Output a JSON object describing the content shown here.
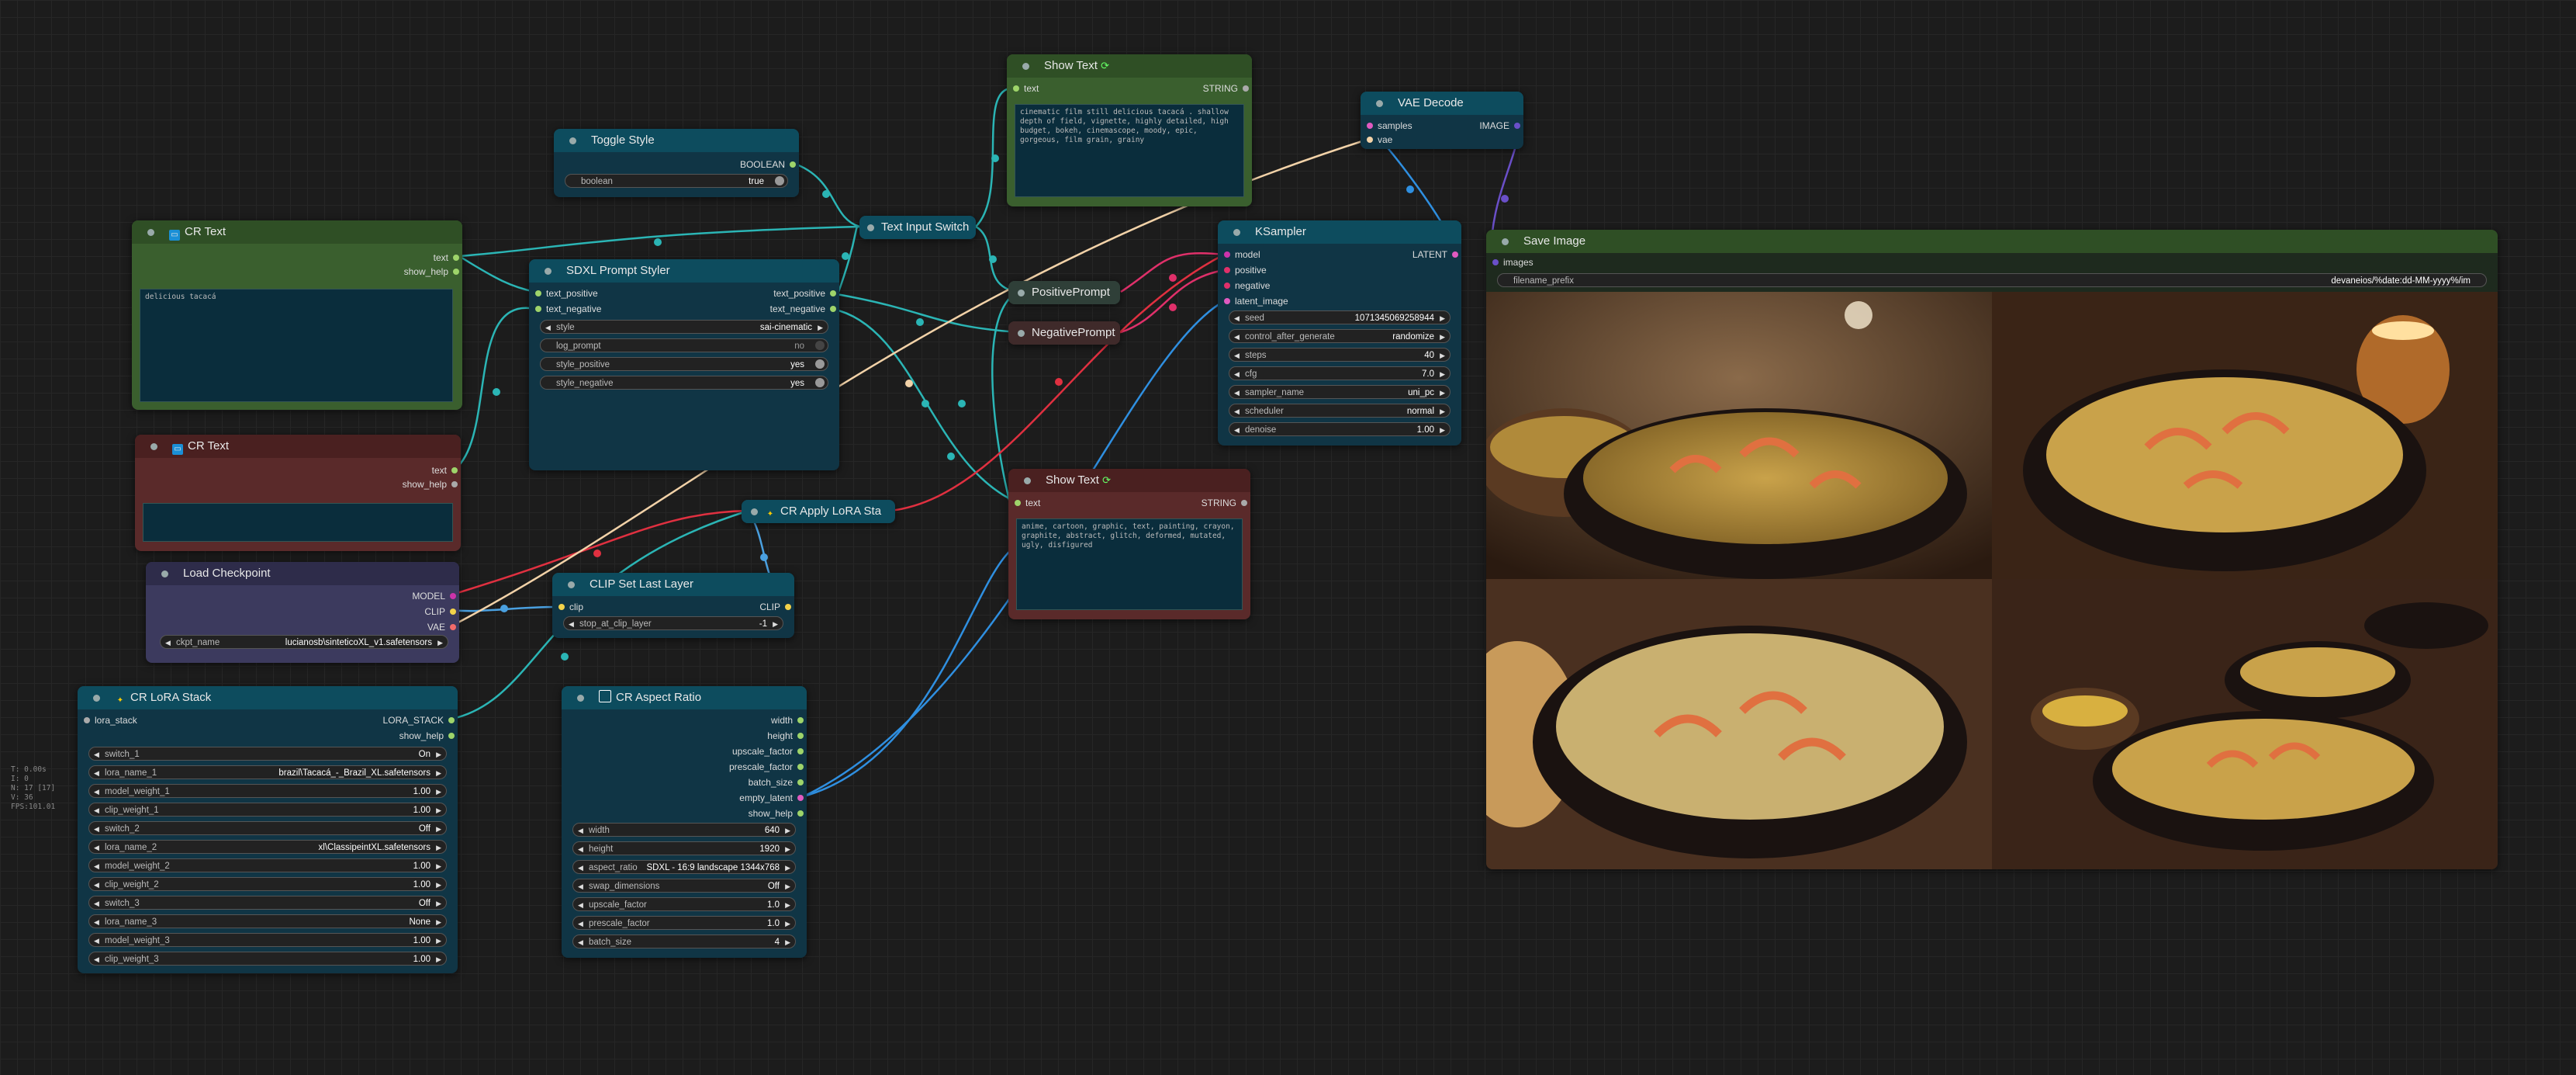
{
  "stats": [
    "T: 0.00s",
    "I: 0",
    "N: 17 [17]",
    "V: 36",
    "FPS:101.01"
  ],
  "cr_text_1": {
    "title": "CR Text",
    "out_text": "text",
    "out_help": "show_help",
    "value": "delicious tacacá"
  },
  "cr_text_2": {
    "title": "CR Text",
    "out_text": "text",
    "out_help": "show_help",
    "value": ""
  },
  "toggle": {
    "title": "Toggle Style",
    "out": "BOOLEAN",
    "w_label": "boolean",
    "w_value": "true"
  },
  "text_switch": {
    "title": "Text Input Switch"
  },
  "sdxl": {
    "title": "SDXL Prompt Styler",
    "in1": "text_positive",
    "in2": "text_negative",
    "out1": "text_positive",
    "out2": "text_negative",
    "widgets": [
      {
        "label": "style",
        "value": "sai-cinematic"
      },
      {
        "label": "log_prompt",
        "value": "no"
      },
      {
        "label": "style_positive",
        "value": "yes"
      },
      {
        "label": "style_negative",
        "value": "yes"
      }
    ]
  },
  "show_text_1": {
    "title": "Show Text",
    "in": "text",
    "out": "STRING",
    "value": "cinematic film still delicious tacacá . shallow depth of field, vignette, highly detailed, high budget, bokeh, cinemascope, moody, epic, gorgeous, film grain, grainy"
  },
  "show_text_2": {
    "title": "Show Text",
    "in": "text",
    "out": "STRING",
    "value": "anime, cartoon, graphic, text, painting, crayon, graphite, abstract, glitch, deformed, mutated, ugly, disfigured"
  },
  "pos_prompt": {
    "title": "PositivePrompt"
  },
  "neg_prompt": {
    "title": "NegativePrompt"
  },
  "vae_decode": {
    "title": "VAE Decode",
    "in1": "samples",
    "in2": "vae",
    "out": "IMAGE"
  },
  "ksampler": {
    "title": "KSampler",
    "inputs": [
      "model",
      "positive",
      "negative",
      "latent_image"
    ],
    "out": "LATENT",
    "widgets": [
      {
        "label": "seed",
        "value": "1071345069258944"
      },
      {
        "label": "control_after_generate",
        "value": "randomize"
      },
      {
        "label": "steps",
        "value": "40"
      },
      {
        "label": "cfg",
        "value": "7.0"
      },
      {
        "label": "sampler_name",
        "value": "uni_pc"
      },
      {
        "label": "scheduler",
        "value": "normal"
      },
      {
        "label": "denoise",
        "value": "1.00"
      }
    ]
  },
  "save_image": {
    "title": "Save Image",
    "in": "images",
    "w_label": "filename_prefix",
    "w_value": "devaneios/%date:dd-MM-yyyy%/im"
  },
  "lora_apply": {
    "title": "CR Apply LoRA Sta"
  },
  "checkpoint": {
    "title": "Load Checkpoint",
    "outs": [
      "MODEL",
      "CLIP",
      "VAE"
    ],
    "w_label": "ckpt_name",
    "w_value": "lucianosb\\sinteticoXL_v1.safetensors"
  },
  "clip_last": {
    "title": "CLIP Set Last Layer",
    "in": "clip",
    "out": "CLIP",
    "w_label": "stop_at_clip_layer",
    "w_value": "-1"
  },
  "lora_stack": {
    "title": "CR LoRA Stack",
    "in": "lora_stack",
    "out1": "LORA_STACK",
    "out2": "show_help",
    "widgets": [
      {
        "label": "switch_1",
        "value": "On"
      },
      {
        "label": "lora_name_1",
        "value": "brazil\\Tacacá_-_Brazil_XL.safetensors"
      },
      {
        "label": "model_weight_1",
        "value": "1.00"
      },
      {
        "label": "clip_weight_1",
        "value": "1.00"
      },
      {
        "label": "switch_2",
        "value": "Off"
      },
      {
        "label": "lora_name_2",
        "value": "xl\\ClassipeintXL.safetensors"
      },
      {
        "label": "model_weight_2",
        "value": "1.00"
      },
      {
        "label": "clip_weight_2",
        "value": "1.00"
      },
      {
        "label": "switch_3",
        "value": "Off"
      },
      {
        "label": "lora_name_3",
        "value": "None"
      },
      {
        "label": "model_weight_3",
        "value": "1.00"
      },
      {
        "label": "clip_weight_3",
        "value": "1.00"
      }
    ]
  },
  "aspect": {
    "title": "CR Aspect Ratio",
    "outs": [
      "width",
      "height",
      "upscale_factor",
      "prescale_factor",
      "batch_size",
      "empty_latent",
      "show_help"
    ],
    "widgets": [
      {
        "label": "width",
        "value": "640"
      },
      {
        "label": "height",
        "value": "1920"
      },
      {
        "label": "aspect_ratio",
        "value": "SDXL - 16:9 landscape 1344x768"
      },
      {
        "label": "swap_dimensions",
        "value": "Off"
      },
      {
        "label": "upscale_factor",
        "value": "1.0"
      },
      {
        "label": "prescale_factor",
        "value": "1.0"
      },
      {
        "label": "batch_size",
        "value": "4"
      }
    ]
  },
  "colors": {
    "teal": "#0d4c5e",
    "green": "#3a5f2e",
    "red": "#5a2a2a",
    "purple": "#3c3a5e"
  }
}
